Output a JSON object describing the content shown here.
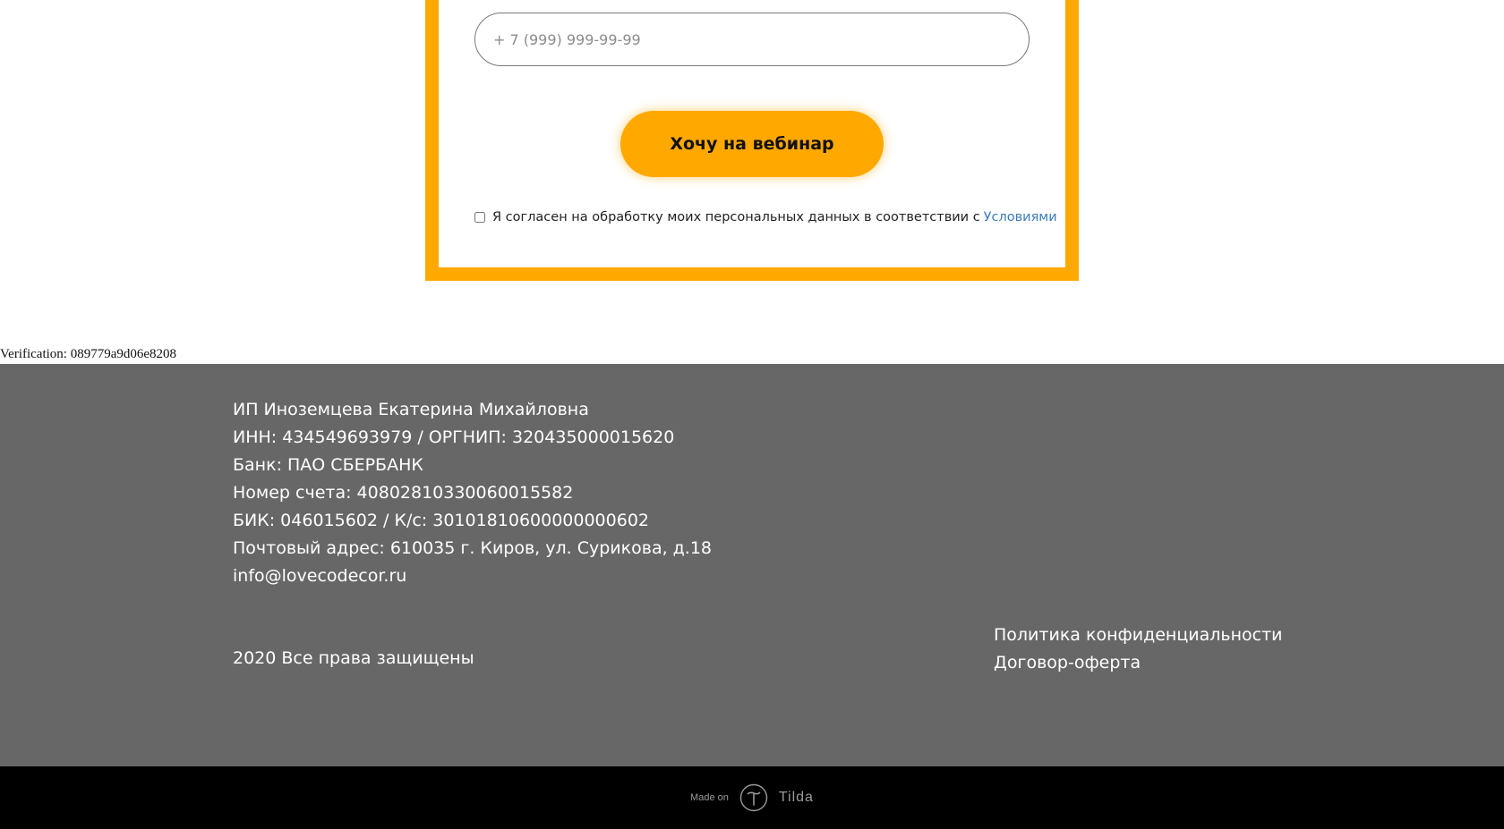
{
  "form": {
    "phone_placeholder": "+ 7 (999) 999-99-99",
    "submit_label": "Хочу на вебинар",
    "consent_text": "Я согласен на обработку моих персональных данных в соответствии с",
    "consent_link": "Условиями",
    "consent_checked": false
  },
  "verification": "Verification: 089779a9d06e8208",
  "footer": {
    "company_lines": [
      "ИП Иноземцева Екатерина Михайловна",
      "ИНН: 434549693979 / ОРГНИП: 320435000015620",
      "Банк: ПАО СБЕРБАНК",
      "Номер счета: 40802810330060015582",
      "БИК: 046015602 / К/с: 30101810600000000602",
      "Почтовый адрес: 610035 г. Киров, ул. Сурикова, д.18",
      "info@lovecodecor.ru"
    ],
    "copyright": "2020 Все права защищены",
    "links": [
      "Политика конфиденциальности",
      "Договор-оферта"
    ]
  },
  "made_on": {
    "label": "Made on",
    "brand": "Tilda",
    "icon": "tilda-logo-icon"
  },
  "colors": {
    "accent": "#ffa800",
    "footer_bg": "#676767",
    "bottom_bg": "#000000",
    "link": "#3a7dbd"
  }
}
